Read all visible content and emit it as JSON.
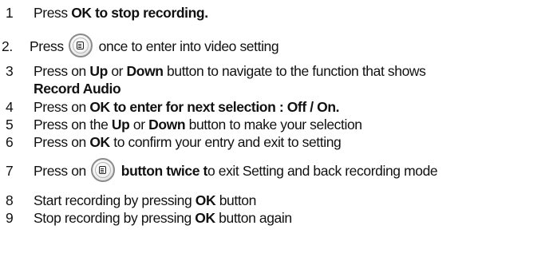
{
  "steps": [
    {
      "num": "1",
      "parts": {
        "b1": "Press ",
        "bold1": "OK to stop recording."
      }
    },
    {
      "num": "2.",
      "parts": {
        "pre": "Press ",
        "post": " once to enter into video setting"
      }
    },
    {
      "num": "3",
      "parts": {
        "a": "Press on ",
        "up": "Up",
        "or": " or ",
        "down": "Down",
        "rest": " button to navigate to the function that shows",
        "line2": "Record Audio"
      }
    },
    {
      "num": "4",
      "parts": {
        "a": "Press on ",
        "bold": "OK to enter for next selection : Off / On."
      }
    },
    {
      "num": "5",
      "parts": {
        "a": "Press on the ",
        "up": "Up",
        "or": " or ",
        "down": "Down",
        "rest": " button to make your selection"
      }
    },
    {
      "num": "6",
      "parts": {
        "a": "Press on ",
        "ok": "OK",
        "rest": " to confirm your entry and exit to setting"
      }
    },
    {
      "num": "7",
      "parts": {
        "a": "Press on ",
        "bold": " button twice t",
        "rest": "o exit Setting and back recording mode"
      }
    },
    {
      "num": "8",
      "parts": {
        "a": "Start recording by pressing ",
        "ok": "OK",
        "rest": " button"
      }
    },
    {
      "num": "9",
      "parts": {
        "a": "Stop recording by pressing ",
        "ok": "OK",
        "rest": " button again"
      }
    }
  ],
  "icons": {
    "menu_button": "menu-button-icon"
  }
}
